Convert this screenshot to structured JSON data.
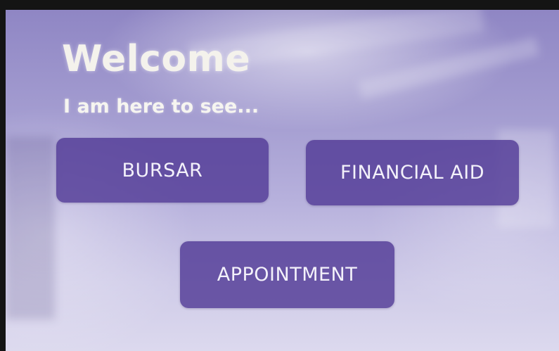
{
  "kiosk": {
    "title": "Welcome",
    "subtitle": "I am here to see...",
    "buttons": {
      "bursar": "BURSAR",
      "financial_aid": "FINANCIAL AID",
      "appointment": "APPOINTMENT"
    },
    "colors": {
      "button_fill": "#523a96",
      "title_text": "#f4f2ec",
      "background": "#a39cd0"
    }
  }
}
